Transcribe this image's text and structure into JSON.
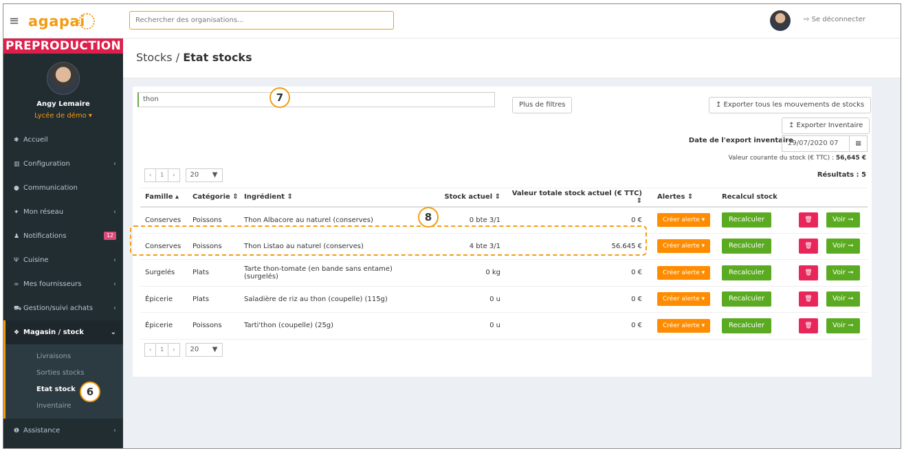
{
  "sidebar": {
    "logo": "agapai",
    "environment_banner": "PREPRODUCTION",
    "user_name": "Angy Lemaire",
    "school": "Lycée de démo ▾",
    "menu": [
      {
        "icon": "home-icon",
        "glyph": "✱",
        "label": "Accueil",
        "chevron": ""
      },
      {
        "icon": "bank-icon",
        "glyph": "▥",
        "label": "Configuration",
        "chevron": "‹"
      },
      {
        "icon": "chat-icon",
        "glyph": "●",
        "label": "Communication",
        "chevron": ""
      },
      {
        "icon": "users-icon",
        "glyph": "✦",
        "label": "Mon réseau",
        "chevron": "‹"
      },
      {
        "icon": "bell-icon",
        "glyph": "♟",
        "label": "Notifications",
        "badge": "12"
      },
      {
        "icon": "cutlery-icon",
        "glyph": "Ψ",
        "label": "Cuisine",
        "chevron": "‹"
      },
      {
        "icon": "handshake-icon",
        "glyph": "∞",
        "label": "Mes fournisseurs",
        "chevron": "‹"
      },
      {
        "icon": "cart-icon",
        "glyph": "⛟",
        "label": "Gestion/suivi achats",
        "chevron": "‹"
      }
    ],
    "active_menu": {
      "icon": "cubes-icon",
      "glyph": "❖",
      "label": "Magasin / stock",
      "chevron": "⌄"
    },
    "submenu": [
      "Livraisons",
      "Sorties stocks",
      "Etat stock",
      "Inventaire"
    ],
    "assistance": {
      "icon": "info-icon",
      "glyph": "❶",
      "label": "Assistance",
      "chevron": "‹"
    }
  },
  "topbar": {
    "search_placeholder": "Rechercher des organisations...",
    "logout_icon": "⇨",
    "logout": "Se déconnecter"
  },
  "page": {
    "breadcrumb_parent": "Stocks /",
    "title": "Etat stocks"
  },
  "filters": {
    "search_value": "thon",
    "more_filters": "Plus de filtres",
    "export_movements": "↥ Exporter tous les mouvements de stocks",
    "export_inventory": "↥ Exporter Inventaire",
    "export_date_label": "Date de l'export inventaire",
    "export_date": "29/07/2020 07",
    "stock_value_label": "Valeur courante du stock (€ TTC) :",
    "stock_value": "56,645 €",
    "results": "Résultats : 5"
  },
  "pagination": {
    "prev": "‹",
    "page": "1",
    "next": "›",
    "page_size": "20",
    "caret": "▼"
  },
  "table": {
    "headers": {
      "famille": "Famille ▴",
      "categorie": "Catégorie ⇕",
      "ingredient": "Ingrédient ⇕",
      "stock": "Stock actuel ⇕",
      "valeur": "Valeur totale stock actuel (€ TTC) ⇕",
      "alertes": "Alertes ⇕",
      "recalcul": "Recalcul stock"
    },
    "rows": [
      {
        "famille": "Conserves",
        "categorie": "Poissons",
        "ingredient": "Thon Albacore au naturel (conserves)",
        "stock": "0 bte 3/1",
        "valeur": "0 €"
      },
      {
        "famille": "Conserves",
        "categorie": "Poissons",
        "ingredient": "Thon Listao au naturel (conserves)",
        "stock": "4 bte 3/1",
        "valeur": "56.645 €"
      },
      {
        "famille": "Surgelés",
        "categorie": "Plats",
        "ingredient": "Tarte thon-tomate (en bande sans entame) (surgelés)",
        "stock": "0 kg",
        "valeur": "0 €"
      },
      {
        "famille": "Épicerie",
        "categorie": "Plats",
        "ingredient": "Saladière de riz au thon (coupelle) (115g)",
        "stock": "0 u",
        "valeur": "0 €"
      },
      {
        "famille": "Épicerie",
        "categorie": "Poissons",
        "ingredient": "Tarti'thon (coupelle) (25g)",
        "stock": "0 u",
        "valeur": "0 €"
      }
    ],
    "actions": {
      "alert": "Créer alerte ▾",
      "recalc": "Recalculer",
      "delete_glyph": "🗑",
      "view": "Voir ➞"
    }
  },
  "annotations": {
    "m6": "6",
    "m7": "7",
    "m8": "8"
  },
  "colors": {
    "accent": "#f39c12",
    "sidebar": "#222d32",
    "preprod": "#dd1f4b",
    "green": "#5aab21",
    "orange": "#ff8c00",
    "red": "#e8265a"
  }
}
